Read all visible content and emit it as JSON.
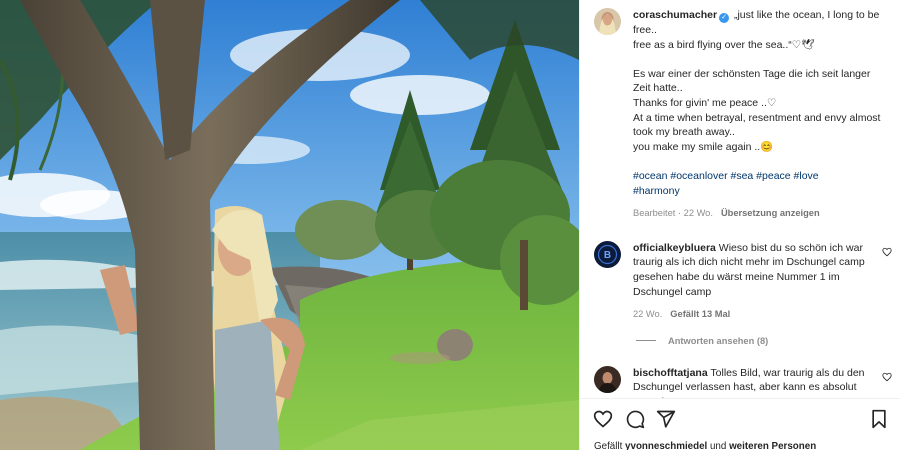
{
  "post": {
    "author": "coraschumacher",
    "caption_lines": [
      "„just like the ocean, I long to be free..",
      "free as a bird flying over the sea..“♡🕊",
      "",
      "Es war einer der schönsten Tage die ich seit langer Zeit hatte..",
      "Thanks for givin' me peace ..♡",
      "At a time when betrayal, resentment and envy almost took my breath away..",
      "you make my smile again ..😊",
      ""
    ],
    "hashtags_line1": "#ocean #oceanlover #sea #peace #love",
    "hashtags_line2": "#harmony",
    "edited_label": "Bearbeitet",
    "age": "22 Wo.",
    "translate_label": "Übersetzung anzeigen"
  },
  "comments": [
    {
      "user": "officialkeybluera",
      "text": "Wieso bist du so schön ich war traurig als ich dich nicht mehr im Dschungel camp gesehen habe du wärst meine Nummer 1 im Dschungel camp",
      "age": "22 Wo.",
      "likes": "Gefällt 13 Mal",
      "replies_label": "Antworten ansehen (8)",
      "avatar_letter": "B"
    },
    {
      "user": "bischofftatjana",
      "text": "Tolles Bild, war traurig als du den Dschungel verlassen hast, aber kann es absolut verstehen.",
      "hearts": "❤❤❤"
    }
  ],
  "likes_line": {
    "prefix": "Gefällt ",
    "user": "yvonneschmiedel",
    "middle": " und ",
    "others": "weiteren Personen"
  },
  "icons": [
    "heart-icon",
    "comment-icon",
    "share-icon",
    "bookmark-icon",
    "verified-badge-icon"
  ],
  "colors": {
    "link": "#00376b",
    "meta": "#8e8e8e",
    "verified": "#3897f0",
    "red-heart": "#ed4956"
  }
}
